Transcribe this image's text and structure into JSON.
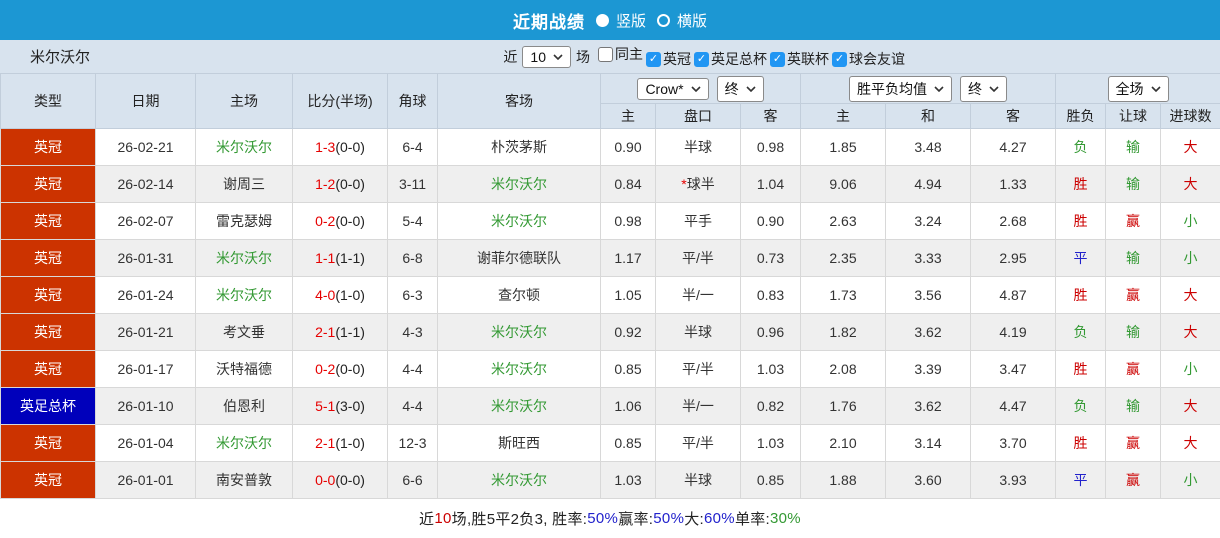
{
  "titlebar": {
    "title": "近期战绩",
    "vertical_label": "竖版",
    "horizontal_label": "横版"
  },
  "filterbar": {
    "team": "米尔沃尔",
    "near_label": "近",
    "count": "10",
    "games_label": "场",
    "filters": [
      {
        "label": "同主",
        "checked": false
      },
      {
        "label": "英冠",
        "checked": true
      },
      {
        "label": "英足总杯",
        "checked": true
      },
      {
        "label": "英联杯",
        "checked": true
      },
      {
        "label": "球会友谊",
        "checked": true
      }
    ]
  },
  "table": {
    "columns": [
      "类型",
      "日期",
      "主场",
      "比分(半场)",
      "角球",
      "客场"
    ],
    "dropdowns": {
      "odds_company": "Crow*",
      "odds_stage": "终",
      "avg_type": "胜平负均值",
      "avg_stage": "终",
      "scope": "全场"
    },
    "subheaders": [
      "主",
      "盘口",
      "客",
      "主",
      "和",
      "客",
      "胜负",
      "让球",
      "进球数"
    ],
    "league_colors": {
      "英冠": "#cc3300",
      "英足总杯": "#0000bb"
    },
    "rows": [
      {
        "league": "英冠",
        "date": "26-02-21",
        "home": "米尔沃尔",
        "home_green": true,
        "score": "1-3",
        "half": "(0-0)",
        "corners": "6-4",
        "away": "朴茨茅斯",
        "away_green": false,
        "odds_home": "0.90",
        "handicap": "半球",
        "star": false,
        "odds_away": "0.98",
        "avg_win": "1.85",
        "avg_draw": "3.48",
        "avg_lose": "4.27",
        "result": "负",
        "result_color": "green",
        "handicap_result": "输",
        "handicap_result_color": "green",
        "goals_result": "大",
        "goals_result_color": "red"
      },
      {
        "league": "英冠",
        "date": "26-02-14",
        "home": "谢周三",
        "home_green": false,
        "score": "1-2",
        "half": "(0-0)",
        "corners": "3-11",
        "away": "米尔沃尔",
        "away_green": true,
        "odds_home": "0.84",
        "handicap": "球半",
        "star": true,
        "odds_away": "1.04",
        "avg_win": "9.06",
        "avg_draw": "4.94",
        "avg_lose": "1.33",
        "result": "胜",
        "result_color": "red",
        "handicap_result": "输",
        "handicap_result_color": "green",
        "goals_result": "大",
        "goals_result_color": "red"
      },
      {
        "league": "英冠",
        "date": "26-02-07",
        "home": "雷克瑟姆",
        "home_green": false,
        "score": "0-2",
        "half": "(0-0)",
        "corners": "5-4",
        "away": "米尔沃尔",
        "away_green": true,
        "odds_home": "0.98",
        "handicap": "平手",
        "star": false,
        "odds_away": "0.90",
        "avg_win": "2.63",
        "avg_draw": "3.24",
        "avg_lose": "2.68",
        "result": "胜",
        "result_color": "red",
        "handicap_result": "赢",
        "handicap_result_color": "red",
        "goals_result": "小",
        "goals_result_color": "green"
      },
      {
        "league": "英冠",
        "date": "26-01-31",
        "home": "米尔沃尔",
        "home_green": true,
        "score": "1-1",
        "half": "(1-1)",
        "corners": "6-8",
        "away": "谢菲尔德联队",
        "away_green": false,
        "odds_home": "1.17",
        "handicap": "平/半",
        "star": false,
        "odds_away": "0.73",
        "avg_win": "2.35",
        "avg_draw": "3.33",
        "avg_lose": "2.95",
        "result": "平",
        "result_color": "blue",
        "handicap_result": "输",
        "handicap_result_color": "green",
        "goals_result": "小",
        "goals_result_color": "green"
      },
      {
        "league": "英冠",
        "date": "26-01-24",
        "home": "米尔沃尔",
        "home_green": true,
        "score": "4-0",
        "half": "(1-0)",
        "corners": "6-3",
        "away": "查尔顿",
        "away_green": false,
        "odds_home": "1.05",
        "handicap": "半/一",
        "star": false,
        "odds_away": "0.83",
        "avg_win": "1.73",
        "avg_draw": "3.56",
        "avg_lose": "4.87",
        "result": "胜",
        "result_color": "red",
        "handicap_result": "赢",
        "handicap_result_color": "red",
        "goals_result": "大",
        "goals_result_color": "red"
      },
      {
        "league": "英冠",
        "date": "26-01-21",
        "home": "考文垂",
        "home_green": false,
        "score": "2-1",
        "half": "(1-1)",
        "corners": "4-3",
        "away": "米尔沃尔",
        "away_green": true,
        "odds_home": "0.92",
        "handicap": "半球",
        "star": false,
        "odds_away": "0.96",
        "avg_win": "1.82",
        "avg_draw": "3.62",
        "avg_lose": "4.19",
        "result": "负",
        "result_color": "green",
        "handicap_result": "输",
        "handicap_result_color": "green",
        "goals_result": "大",
        "goals_result_color": "red"
      },
      {
        "league": "英冠",
        "date": "26-01-17",
        "home": "沃特福德",
        "home_green": false,
        "score": "0-2",
        "half": "(0-0)",
        "corners": "4-4",
        "away": "米尔沃尔",
        "away_green": true,
        "odds_home": "0.85",
        "handicap": "平/半",
        "star": false,
        "odds_away": "1.03",
        "avg_win": "2.08",
        "avg_draw": "3.39",
        "avg_lose": "3.47",
        "result": "胜",
        "result_color": "red",
        "handicap_result": "赢",
        "handicap_result_color": "red",
        "goals_result": "小",
        "goals_result_color": "green"
      },
      {
        "league": "英足总杯",
        "date": "26-01-10",
        "home": "伯恩利",
        "home_green": false,
        "score": "5-1",
        "half": "(3-0)",
        "corners": "4-4",
        "away": "米尔沃尔",
        "away_green": true,
        "odds_home": "1.06",
        "handicap": "半/一",
        "star": false,
        "odds_away": "0.82",
        "avg_win": "1.76",
        "avg_draw": "3.62",
        "avg_lose": "4.47",
        "result": "负",
        "result_color": "green",
        "handicap_result": "输",
        "handicap_result_color": "green",
        "goals_result": "大",
        "goals_result_color": "red"
      },
      {
        "league": "英冠",
        "date": "26-01-04",
        "home": "米尔沃尔",
        "home_green": true,
        "score": "2-1",
        "half": "(1-0)",
        "corners": "12-3",
        "away": "斯旺西",
        "away_green": false,
        "odds_home": "0.85",
        "handicap": "平/半",
        "star": false,
        "odds_away": "1.03",
        "avg_win": "2.10",
        "avg_draw": "3.14",
        "avg_lose": "3.70",
        "result": "胜",
        "result_color": "red",
        "handicap_result": "赢",
        "handicap_result_color": "red",
        "goals_result": "大",
        "goals_result_color": "red"
      },
      {
        "league": "英冠",
        "date": "26-01-01",
        "home": "南安普敦",
        "home_green": false,
        "score": "0-0",
        "half": "(0-0)",
        "corners": "6-6",
        "away": "米尔沃尔",
        "away_green": true,
        "odds_home": "1.03",
        "handicap": "半球",
        "star": false,
        "odds_away": "0.85",
        "avg_win": "1.88",
        "avg_draw": "3.60",
        "avg_lose": "3.93",
        "result": "平",
        "result_color": "blue",
        "handicap_result": "赢",
        "handicap_result_color": "red",
        "goals_result": "小",
        "goals_result_color": "green"
      }
    ]
  },
  "summary": {
    "segments": [
      {
        "text": "近",
        "color": "black"
      },
      {
        "text": "10",
        "color": "red"
      },
      {
        "text": "场,胜5平2负3, 胜率:",
        "color": "black"
      },
      {
        "text": "50%",
        "color": "blue"
      },
      {
        "text": " 赢率:",
        "color": "black"
      },
      {
        "text": "50%",
        "color": "blue"
      },
      {
        "text": " 大:",
        "color": "black"
      },
      {
        "text": "60%",
        "color": "blue"
      },
      {
        "text": " 单率:",
        "color": "black"
      },
      {
        "text": "30%",
        "color": "green"
      }
    ]
  },
  "colors": {
    "titlebar_blue": "#1c97d3",
    "header_bg": "#d8e3ee",
    "league_red": "#cc3300",
    "league_blue": "#0000bb",
    "win_red": "#cc0000",
    "lose_green": "#339933",
    "draw_blue": "#2222cc",
    "score_red": "#e60000",
    "checkbox_blue": "#2196f3"
  }
}
